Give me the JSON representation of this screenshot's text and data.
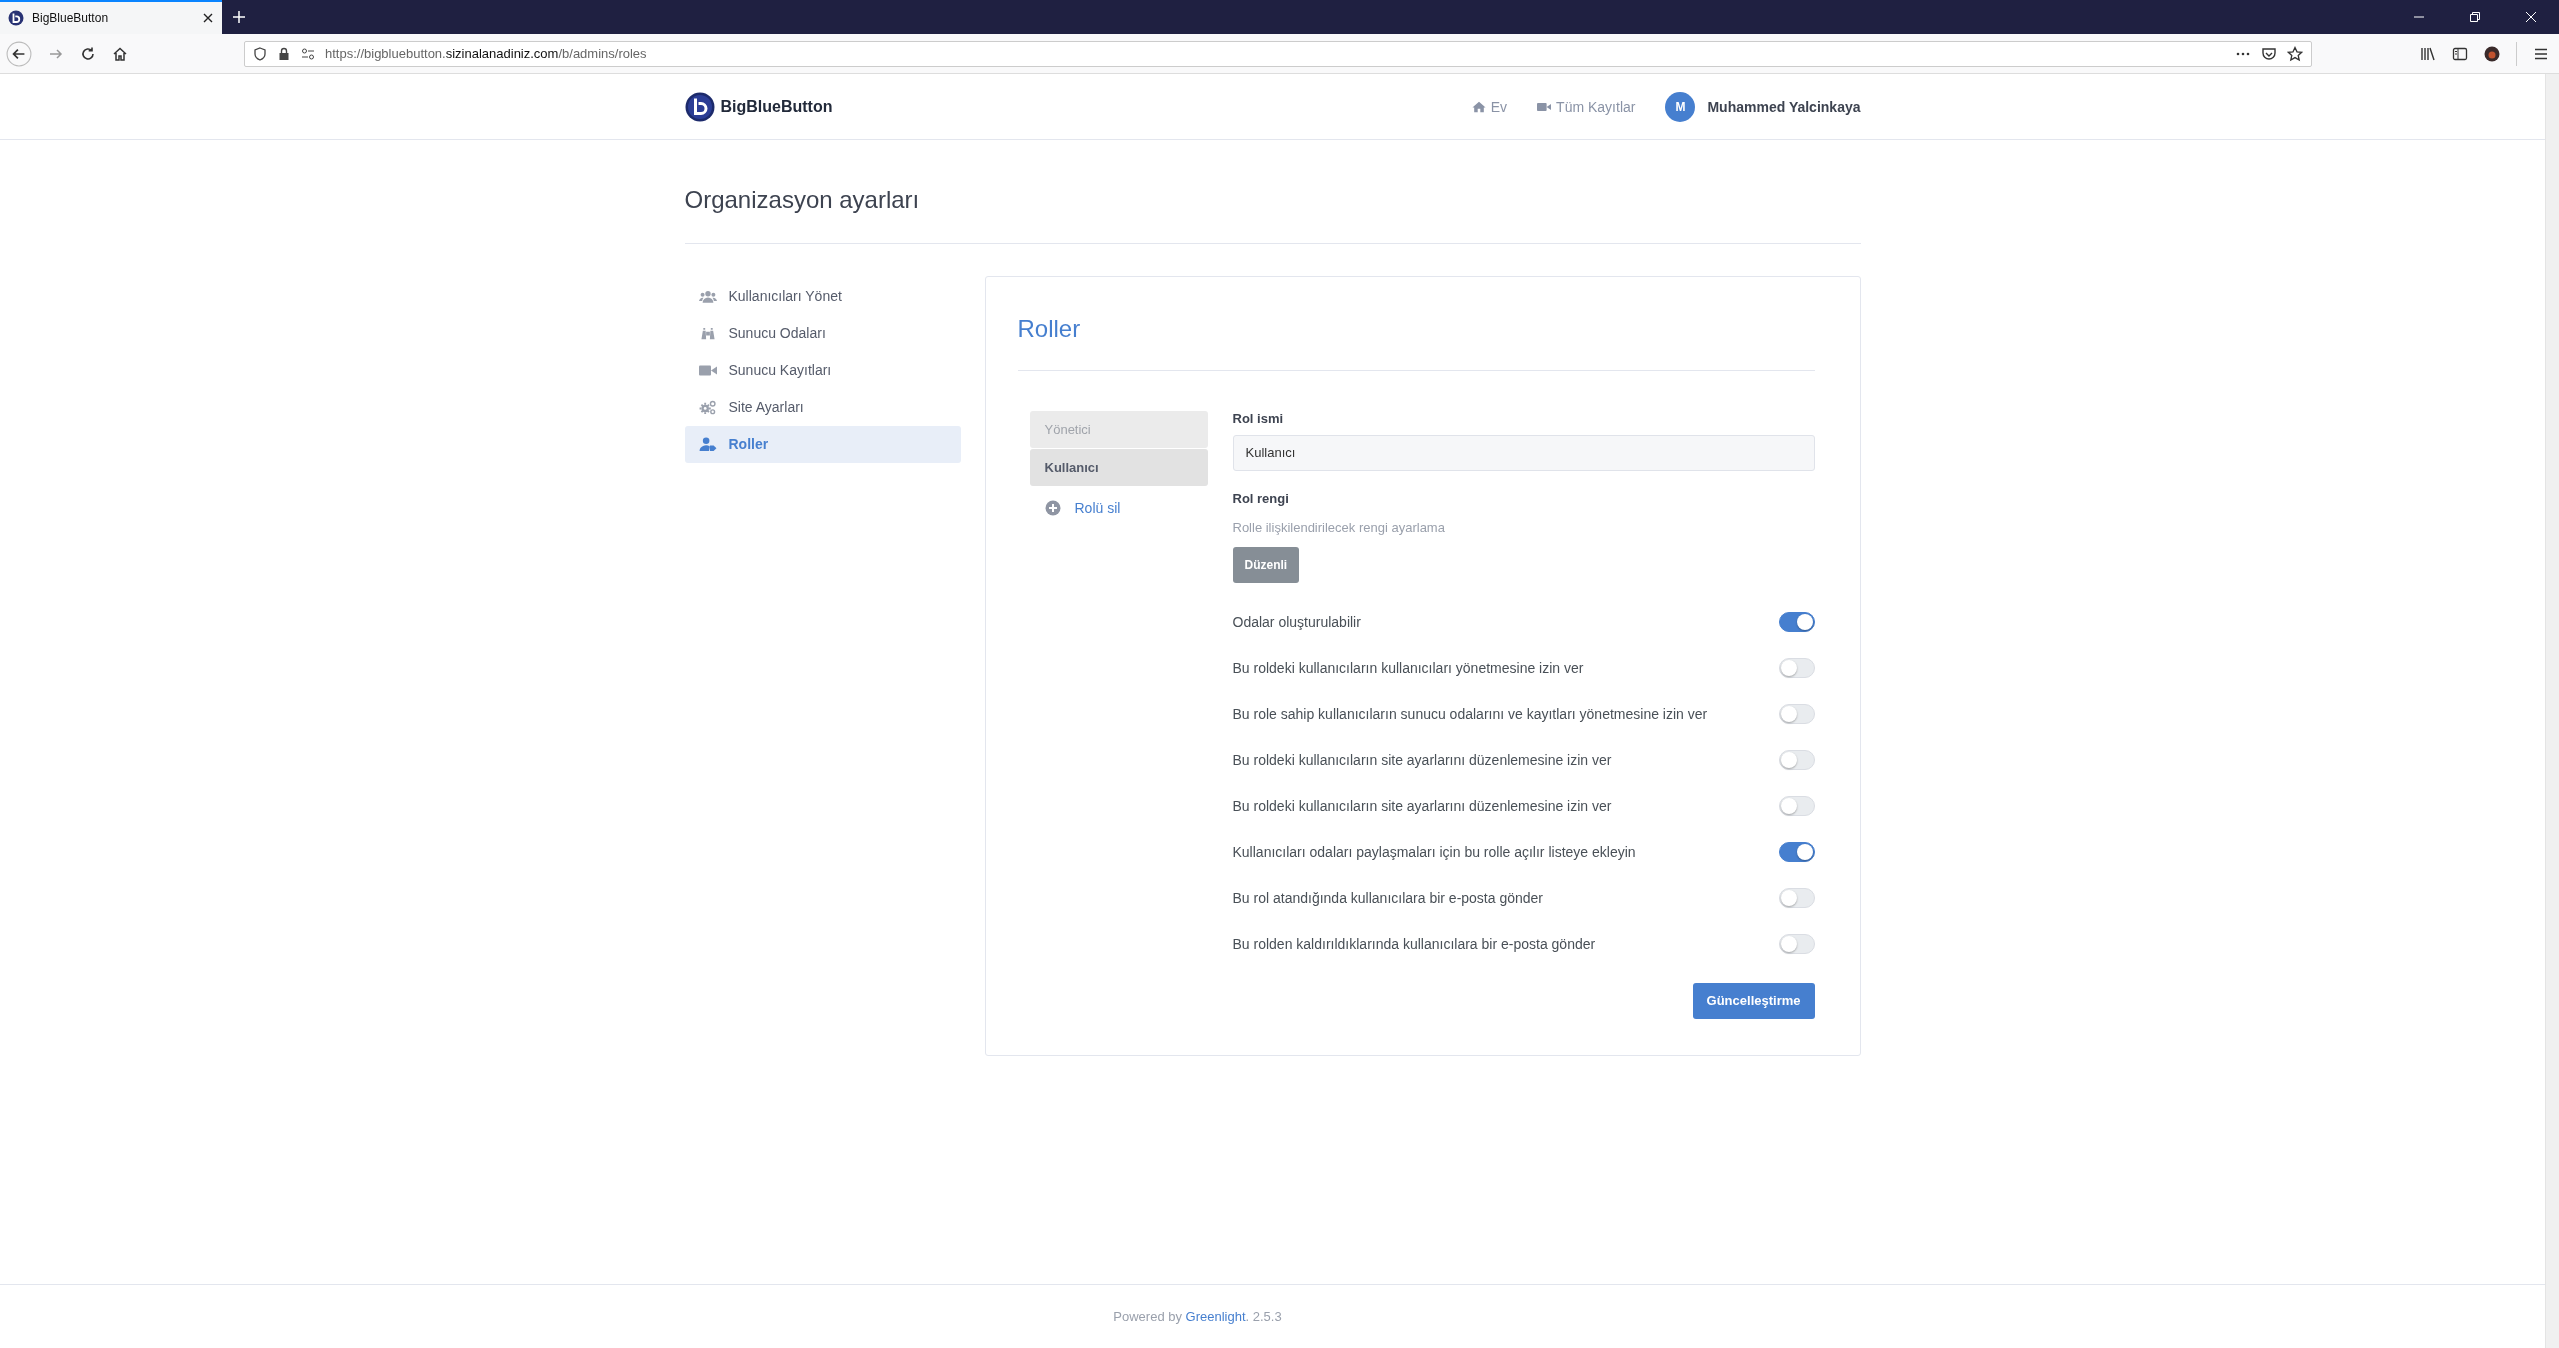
{
  "browser": {
    "tab": {
      "title": "BigBlueButton"
    },
    "address": {
      "prefix": "https://bigbluebutton.",
      "domain": "sizinalanadiniz.com",
      "path": "/b/admins/roles"
    }
  },
  "header": {
    "brand": "BigBlueButton",
    "nav": [
      {
        "label": "Ev"
      },
      {
        "label": "Tüm Kayıtlar"
      }
    ],
    "user": {
      "initial": "M",
      "name": "Muhammed Yalcinkaya"
    }
  },
  "page_title": "Organizasyon ayarları",
  "sidebar": {
    "items": [
      {
        "label": "Kullanıcıları Yönet",
        "selected": false
      },
      {
        "label": "Sunucu Odaları",
        "selected": false
      },
      {
        "label": "Sunucu Kayıtları",
        "selected": false
      },
      {
        "label": "Site Ayarları",
        "selected": false
      },
      {
        "label": "Roller",
        "selected": true
      }
    ]
  },
  "panel": {
    "title": "Roller",
    "roles": [
      {
        "label": "Yönetici",
        "selected": false
      },
      {
        "label": "Kullanıcı",
        "selected": true
      }
    ],
    "delete_role": "Rolü sil",
    "form": {
      "name_label": "Rol ismi",
      "name_value": "Kullanıcı",
      "color_label": "Rol rengi",
      "color_hint": "Rolle ilişkilendirilecek rengi ayarlama",
      "color_button": "Düzenli",
      "permissions": [
        {
          "label": "Odalar oluşturulabilir",
          "on": true
        },
        {
          "label": "Bu roldeki kullanıcıların kullanıcıları yönetmesine izin ver",
          "on": false
        },
        {
          "label": "Bu role sahip kullanıcıların sunucu odalarını ve kayıtları yönetmesine izin ver",
          "on": false
        },
        {
          "label": "Bu roldeki kullanıcıların site ayarlarını düzenlemesine izin ver",
          "on": false
        },
        {
          "label": "Bu roldeki kullanıcıların site ayarlarını düzenlemesine izin ver",
          "on": false
        },
        {
          "label": "Kullanıcıları odaları paylaşmaları için bu rolle açılır listeye ekleyin",
          "on": true
        },
        {
          "label": "Bu rol atandığında kullanıcılara bir e-posta gönder",
          "on": false
        },
        {
          "label": "Bu rolden kaldırıldıklarında kullanıcılara bir e-posta gönder",
          "on": false
        }
      ],
      "submit": "Güncelleştirme"
    }
  },
  "footer": {
    "before": "Powered by",
    "link": "Greenlight",
    "after": ". 2.5.3"
  }
}
